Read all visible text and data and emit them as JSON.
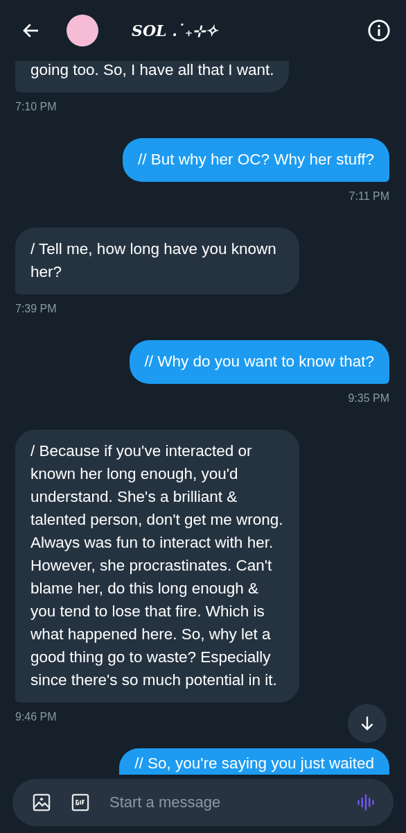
{
  "header": {
    "title": "SOL .˙₊⊹✧"
  },
  "messages": [
    {
      "kind": "incoming",
      "clipped": true,
      "text": "going too. So, I have all that I want.",
      "time": "7:10 PM"
    },
    {
      "kind": "outgoing",
      "clipped": false,
      "text": "// But why her OC? Why her stuff?",
      "time": "7:11 PM"
    },
    {
      "kind": "incoming",
      "clipped": false,
      "text": "/ Tell me, how long have you known her?",
      "time": "7:39 PM"
    },
    {
      "kind": "outgoing",
      "clipped": false,
      "text": "// Why do you want to know that?",
      "time": "9:35 PM"
    },
    {
      "kind": "incoming",
      "clipped": false,
      "text": "/ Because if you've interacted or known her long enough, you'd understand. She's a brilliant & talented person, don't get me wrong. Always was fun to interact with her. However, she procrastinates. Can't blame her, do this long enough & you tend to lose that fire. Which is what happened here. So, why let a good thing go to waste? Especially since there's so much potential in it.",
      "time": "9:46 PM"
    },
    {
      "kind": "outgoing",
      "clipped": true,
      "text": "// So, you're saying you just waited"
    }
  ],
  "composer": {
    "placeholder": "Start a message"
  }
}
